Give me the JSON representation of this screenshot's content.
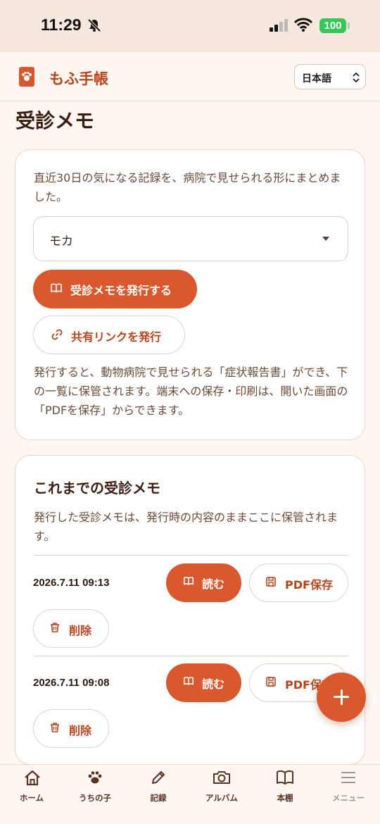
{
  "status": {
    "time": "11:29",
    "battery": "100"
  },
  "app": {
    "name": "もふ手帳",
    "language": "日本語"
  },
  "page": {
    "title": "受診メモ"
  },
  "issue_card": {
    "description": "直近30日の気になる記録を、病院で見せられる形にまとめました。",
    "pet_selected": "モカ",
    "issue_button": "受診メモを発行する",
    "share_button": "共有リンクを発行",
    "note": "発行すると、動物病院で見せられる「症状報告書」ができ、下の一覧に保管されます。端末への保存・印刷は、開いた画面の「PDFを保存」からできます。"
  },
  "history": {
    "title": "これまでの受診メモ",
    "description": "発行した受診メモは、発行時の内容のままここに保管されます。",
    "read_label": "読む",
    "pdf_label": "PDF保存",
    "delete_label": "削除",
    "items": [
      {
        "date": "2026.7.11 09:13"
      },
      {
        "date": "2026.7.11 09:08"
      }
    ]
  },
  "tabs": [
    {
      "label": "ホーム",
      "icon": "home-icon"
    },
    {
      "label": "うちの子",
      "icon": "paw-icon"
    },
    {
      "label": "記録",
      "icon": "pencil-icon"
    },
    {
      "label": "アルバム",
      "icon": "camera-icon"
    },
    {
      "label": "本棚",
      "icon": "book-icon"
    },
    {
      "label": "メニュー",
      "icon": "menu-icon"
    }
  ],
  "colors": {
    "accent": "#d9582d",
    "brand_text": "#b8441c",
    "background": "#fdf6f1"
  }
}
